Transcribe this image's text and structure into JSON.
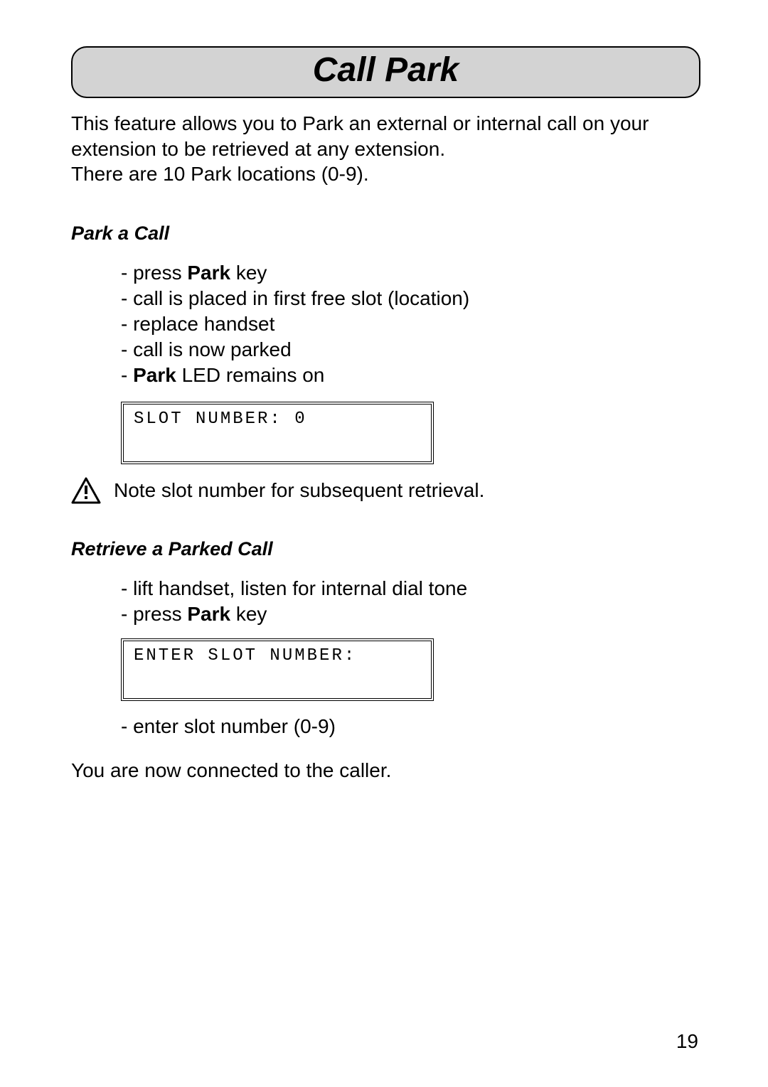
{
  "title": "Call Park",
  "intro_line1": "This feature allows you to Park an external or internal call on your extension to be retrieved at any extension.",
  "intro_line2": "There are 10 Park locations (0-9).",
  "section1": {
    "heading": "Park a Call",
    "steps": {
      "s1_pre": "- press ",
      "s1_bold": "Park",
      "s1_post": " key",
      "s2": "- call is placed in first free slot (location)",
      "s3": "- replace handset",
      "s4": "- call is now parked",
      "s5_pre": "- ",
      "s5_bold": "Park",
      "s5_post": " LED remains on"
    },
    "lcd": "SLOT NUMBER: 0",
    "note": "Note slot number for subsequent retrieval."
  },
  "section2": {
    "heading": "Retrieve a Parked Call",
    "steps": {
      "s1": "- lift handset, listen for internal dial tone",
      "s2_pre": "- press ",
      "s2_bold": "Park",
      "s2_post": " key"
    },
    "lcd": "ENTER SLOT NUMBER:",
    "after": "- enter slot number (0-9)"
  },
  "closing": "You are now connected to the caller.",
  "page_number": "19"
}
